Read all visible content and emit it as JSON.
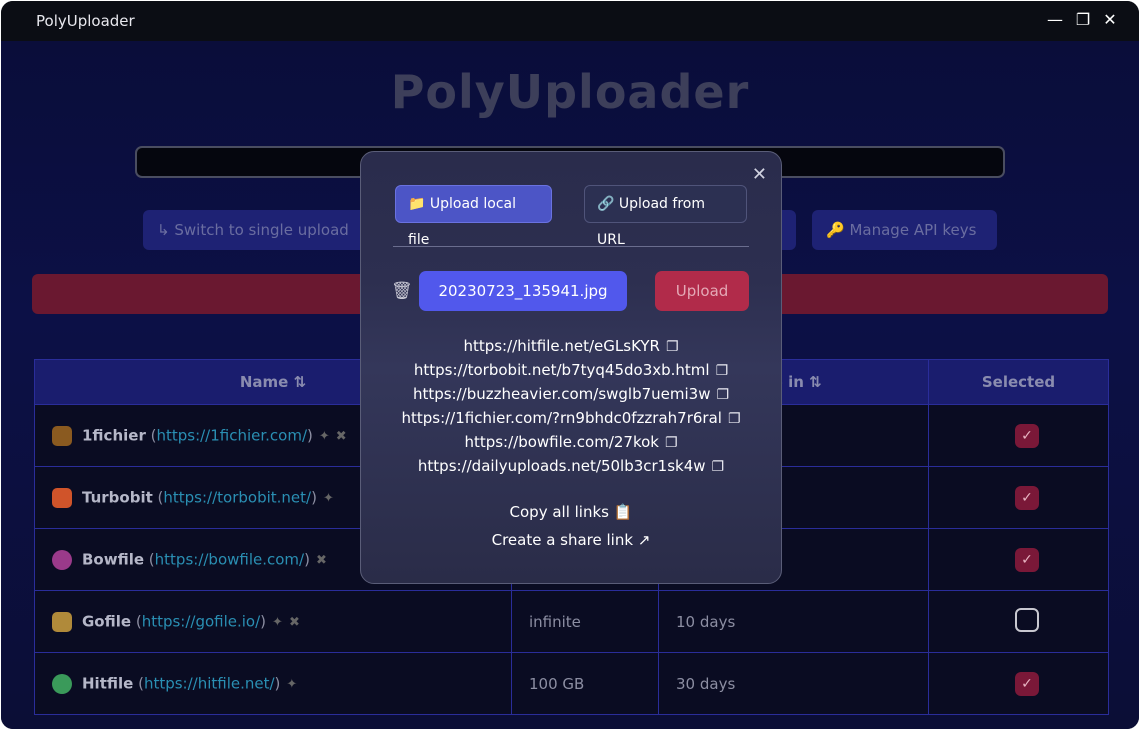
{
  "window": {
    "title": "PolyUploader",
    "controls": [
      "minimize",
      "restore",
      "close"
    ]
  },
  "app": {
    "heading": "PolyUploader",
    "switch_button": "Switch to single upload",
    "api_button": "Manage API keys"
  },
  "table": {
    "headers": {
      "name": "Name",
      "expire": "re in",
      "selected": "Selected"
    },
    "rows": [
      {
        "name": "1fichier",
        "url": "https://1fichier.com/",
        "size": "",
        "expire": "",
        "selected": true
      },
      {
        "name": "Turbobit",
        "url": "https://torbobit.net/",
        "size": "",
        "expire": "",
        "selected": true
      },
      {
        "name": "Bowfile",
        "url": "https://bowfile.com/",
        "size": "",
        "expire": "",
        "selected": true
      },
      {
        "name": "Gofile",
        "url": "https://gofile.io/",
        "size": "infinite",
        "expire": "10 days",
        "selected": false
      },
      {
        "name": "Hitfile",
        "url": "https://hitfile.net/",
        "size": "100 GB",
        "expire": "30 days",
        "selected": true
      }
    ]
  },
  "modal": {
    "tab_local": "Upload local file",
    "tab_url": "Upload from URL",
    "file_name": "20230723_135941.jpg",
    "upload_label": "Upload",
    "links": [
      "https://hitfile.net/eGLsKYR",
      "https://torbobit.net/b7tyq45do3xb.html",
      "https://buzzheavier.com/swglb7uemi3w",
      "https://1fichier.com/?rn9bhdc0fzzrah7r6ral",
      "https://bowfile.com/27kok",
      "https://dailyuploads.net/50lb3cr1sk4w"
    ],
    "copy_all": "Copy all links",
    "share": "Create a share link"
  },
  "colors": {
    "accent": "#5158ec",
    "danger": "#b12b4a",
    "link": "#2a8fb3"
  }
}
